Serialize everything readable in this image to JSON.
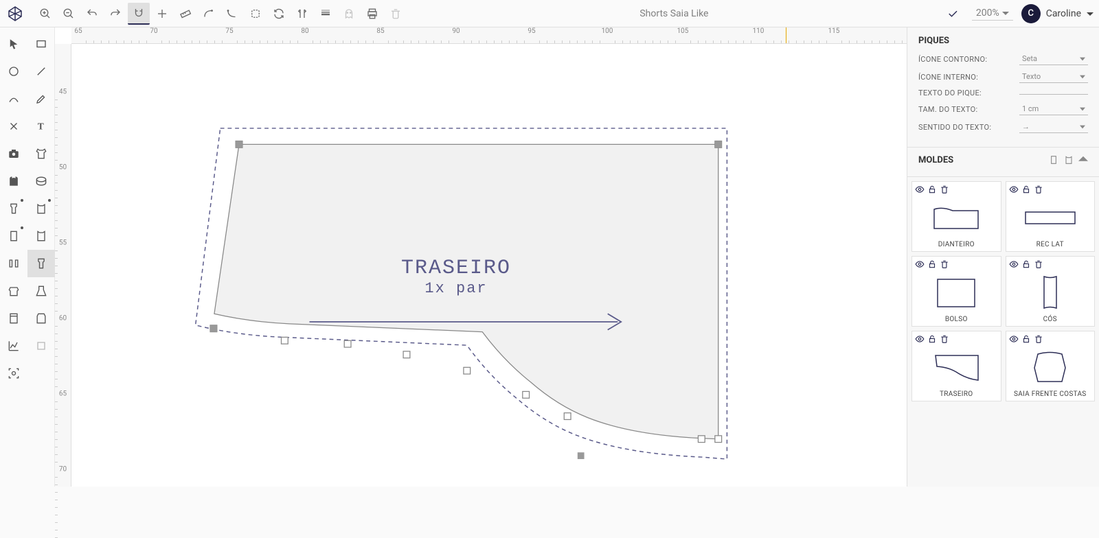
{
  "document_title": "Shorts Saia Like",
  "zoom": "200%",
  "user": {
    "initial": "C",
    "name": "Caroline"
  },
  "ruler_h": [
    "65",
    "70",
    "75",
    "80",
    "85",
    "90",
    "95",
    "100",
    "105",
    "110",
    "115"
  ],
  "ruler_v": [
    "45",
    "50",
    "55",
    "60",
    "65",
    "70"
  ],
  "pattern": {
    "title": "TRASEIRO",
    "subtitle": "1x par"
  },
  "panel_piques": {
    "title": "PIQUES",
    "icone_contorno": {
      "label": "ÍCONE CONTORNO:",
      "value": "Seta"
    },
    "icone_interno": {
      "label": "ÍCONE INTERNO:",
      "value": "Texto"
    },
    "texto_pique": {
      "label": "TEXTO DO PIQUE:",
      "value": ""
    },
    "tam_texto": {
      "label": "TAM. DO TEXTO:",
      "value": "1 cm"
    },
    "sentido_texto": {
      "label": "SENTIDO DO TEXTO:",
      "value": "→"
    }
  },
  "panel_moldes": {
    "title": "MOLDES",
    "items": [
      {
        "name": "DIANTEIRO"
      },
      {
        "name": "REC LAT"
      },
      {
        "name": "BOLSO"
      },
      {
        "name": "CÓS"
      },
      {
        "name": "TRASEIRO"
      },
      {
        "name": "SAIA FRENTE COSTAS"
      }
    ]
  }
}
